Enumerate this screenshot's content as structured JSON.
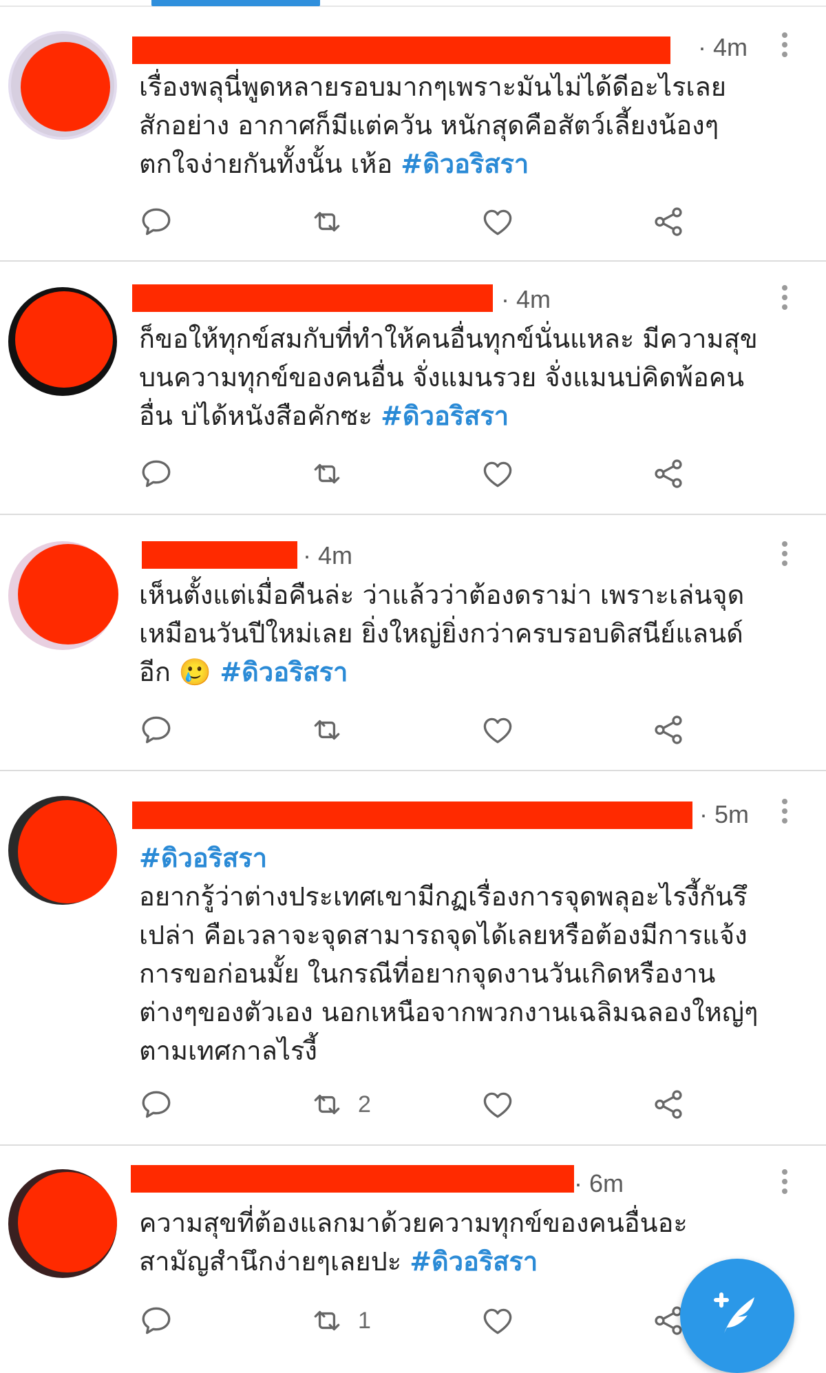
{
  "hashtag": "#ดิวอริสรา",
  "colors": {
    "accent": "#2a8ad6",
    "redaction": "#ff2a00",
    "fab": "#2b98e8"
  },
  "tweets": [
    {
      "time": "· 4m",
      "text": "เรื่องพลุนี่พูดหลายรอบมากๆเพราะมันไม่ได้ดีอะไรเลย\nสักอย่าง อากาศก็มีแต่ควัน หนักสุดคือสัตว์เลี้ยงน้องๆ\nตกใจง่ายกันทั้งนั้น เห้อ ",
      "retweets": ""
    },
    {
      "time": "· 4m",
      "text": "ก็ขอให้ทุกข์สมกับที่ทำให้คนอื่นทุกข์นั่นแหละ มีความสุข\nบนความทุกข์ของคนอื่น จั่งแมนรวย จั่งแมนบ่คิดพ้อคน\nอื่น บ่ได้หนังสือคักซะ ",
      "retweets": ""
    },
    {
      "time": "· 4m",
      "text": "เห็นตั้งแต่เมื่อคืนล่ะ ว่าแล้วว่าต้องดราม่า เพราะเล่นจุด\nเหมือนวันปีใหม่เลย ยิ่งใหญ่ยิ่งกว่าครบรอบดิสนีย์แลนด์\nอีก ",
      "emoji": "🥲",
      "retweets": ""
    },
    {
      "time": "· 5m",
      "text": "อยากรู้ว่าต่างประเทศเขามีกฏเรื่องการจุดพลุอะไรงี้กันรึ\nเปล่า คือเวลาจะจุดสามารถจุดได้เลยหรือต้องมีการแจ้ง\nการขอก่อนมั้ย ในกรณีที่อยากจุดงานวันเกิดหรืองาน\nต่างๆของตัวเอง นอกเหนือจากพวกงานเฉลิมฉลองใหญ่ๆ\nตามเทศกาลไรงี้",
      "retweets": "2"
    },
    {
      "time": "· 6m",
      "text": "ความสุขที่ต้องแลกมาด้วยความทุกข์ของคนอื่นอะ\nสามัญสำนึกง่ายๆเลยปะ ",
      "retweets": "1"
    }
  ],
  "icons": {
    "reply": "reply-icon",
    "retweet": "retweet-icon",
    "like": "heart-icon",
    "share": "share-icon",
    "more": "more-vertical-icon",
    "compose": "compose-tweet-icon"
  }
}
